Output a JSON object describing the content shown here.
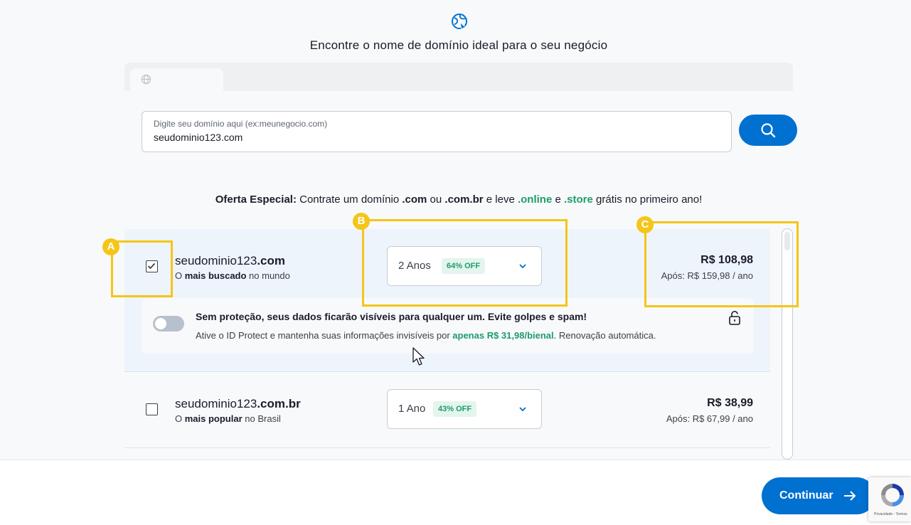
{
  "header": {
    "title": "Encontre o nome de domínio ideal para o seu negócio"
  },
  "search": {
    "label": "Digite seu domínio aqui (ex:meunegocio.com)",
    "value": "seudominio123.com"
  },
  "offer": {
    "strong": "Oferta Especial:",
    "text1": " Contrate um domínio ",
    "ext1": ".com",
    "text2": " ou ",
    "ext2": ".com.br",
    "text3": " e leve ",
    "free1": ".online",
    "text4": " e ",
    "free2": ".store",
    "text5": " grátis no primeiro ano!"
  },
  "domains": [
    {
      "name": "seudominio123",
      "tld": ".com",
      "sub_pre": "O ",
      "sub_bold": "mais buscado",
      "sub_post": " no mundo",
      "period": "2 Anos",
      "discount": "64% OFF",
      "price": "R$ 108,98",
      "renewal": "Após: R$ 159,98 / ano",
      "checked": true
    },
    {
      "name": "seudominio123",
      "tld": ".com.br",
      "sub_pre": "O ",
      "sub_bold": "mais popular",
      "sub_post": " no Brasil",
      "period": "1 Ano",
      "discount": "43% OFF",
      "price": "R$ 38,99",
      "renewal": "Após: R$ 67,99 / ano",
      "checked": false
    }
  ],
  "protect": {
    "title": "Sem proteção, seus dados ficarão visíveis para qualquer um. Evite golpes e spam!",
    "desc_pre": "Ative o ID Protect e mantenha suas informações invisíveis por ",
    "desc_price": "apenas R$ 31,98/bienal",
    "desc_post": ". Renovação automática."
  },
  "markers": {
    "a": "A",
    "b": "B",
    "c": "C"
  },
  "footer": {
    "continue_label": "Continuar"
  },
  "recaptcha": {
    "text": "Privacidade - Termos"
  },
  "colors": {
    "primary": "#0070d1",
    "accent_green": "#1e9c6a",
    "highlight": "#f5c518"
  }
}
